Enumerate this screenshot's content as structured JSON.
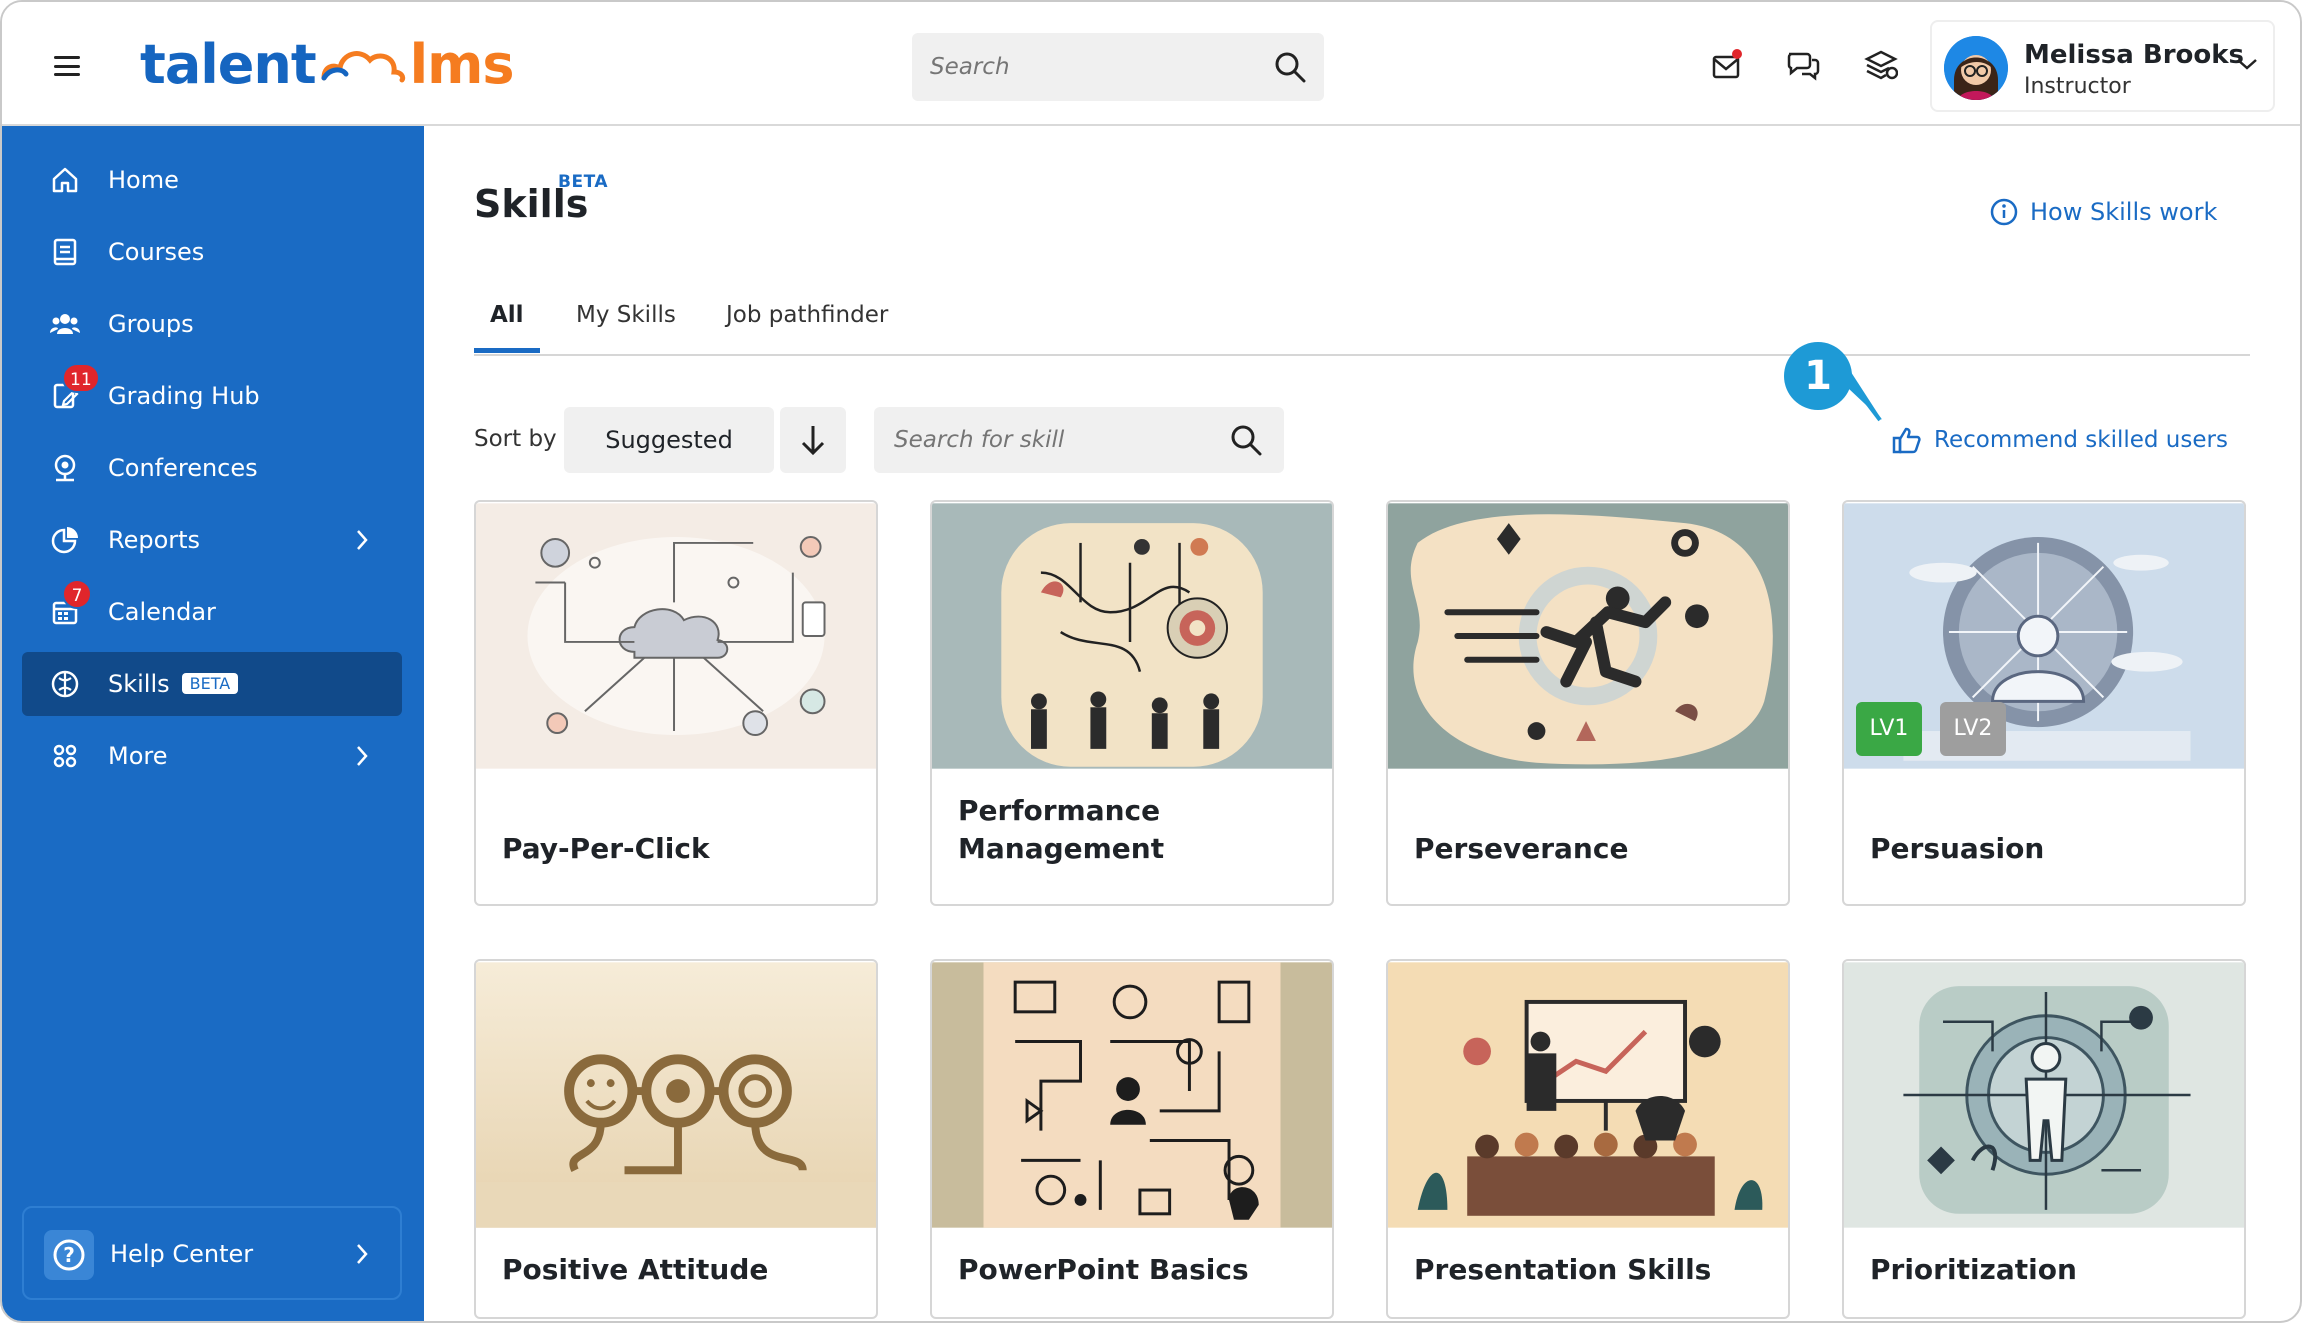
{
  "brand": {
    "talent": "talent",
    "lms": "lms"
  },
  "search": {
    "placeholder": "Search"
  },
  "user": {
    "name": "Melissa Brooks",
    "role": "Instructor"
  },
  "sidebar": {
    "items": [
      {
        "label": "Home",
        "icon": "home-icon"
      },
      {
        "label": "Courses",
        "icon": "book-icon"
      },
      {
        "label": "Groups",
        "icon": "groups-icon"
      },
      {
        "label": "Grading Hub",
        "icon": "grading-icon",
        "badge": "11"
      },
      {
        "label": "Conferences",
        "icon": "conference-icon"
      },
      {
        "label": "Reports",
        "icon": "reports-icon"
      },
      {
        "label": "Calendar",
        "icon": "calendar-icon",
        "badge": "7"
      },
      {
        "label": "Skills",
        "icon": "skills-icon",
        "tag": "BETA"
      },
      {
        "label": "More",
        "icon": "more-icon"
      }
    ],
    "help": "Help Center"
  },
  "page": {
    "title": "Skills",
    "title_badge": "BETA",
    "how_link": "How Skills work",
    "tabs": [
      "All",
      "My Skills",
      "Job pathfinder"
    ],
    "sort_label": "Sort by",
    "sort_value": "Suggested",
    "skill_search_placeholder": "Search for skill",
    "recommend": "Recommend skilled users",
    "callout": "1"
  },
  "cards": [
    {
      "name": "Pay-Per-Click"
    },
    {
      "name": "Performance Management"
    },
    {
      "name": "Perseverance"
    },
    {
      "name": "Persuasion",
      "levels": [
        "LV1",
        "LV2"
      ]
    },
    {
      "name": "Positive Attitude"
    },
    {
      "name": "PowerPoint Basics"
    },
    {
      "name": "Presentation Skills"
    },
    {
      "name": "Prioritization"
    }
  ],
  "colors": {
    "sidebar": "#1a6bc4",
    "active": "#114a8a",
    "accent_orange": "#f57c20",
    "badge_red": "#e0262b",
    "lv1": "#3aa845",
    "lv2": "#9e9e9e"
  }
}
